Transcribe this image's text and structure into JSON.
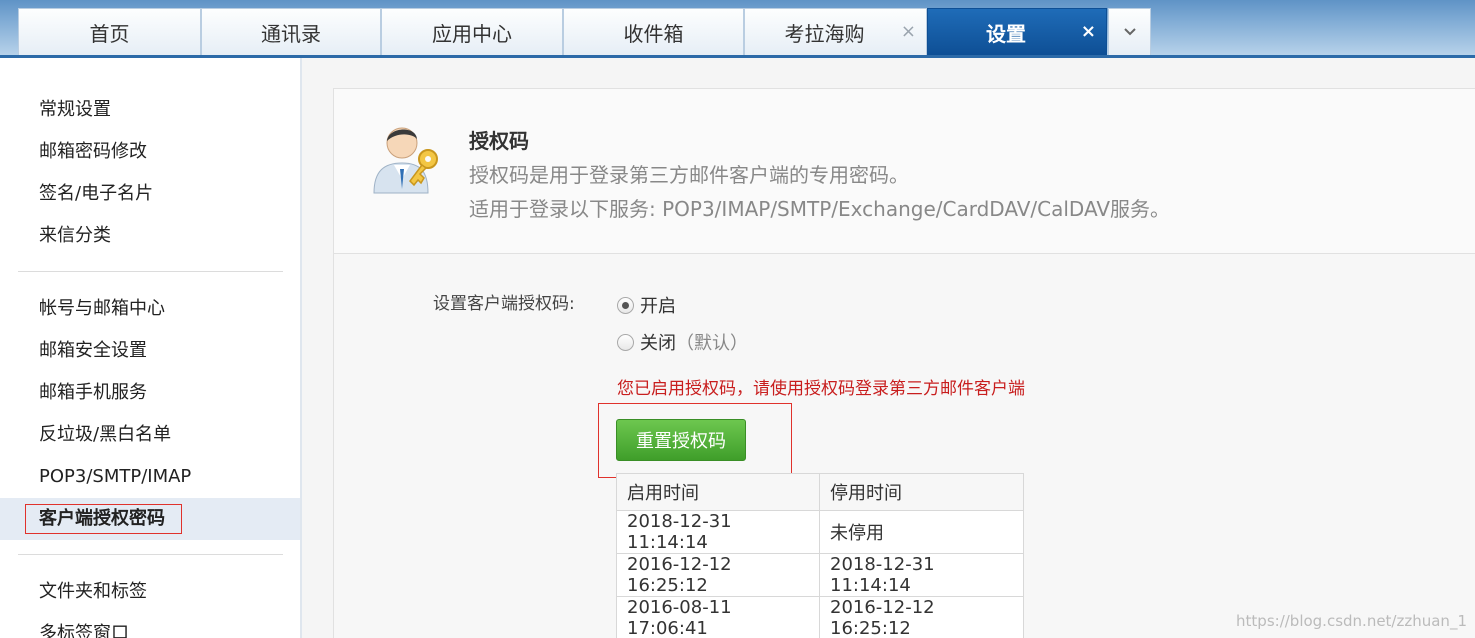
{
  "tabs": [
    {
      "label": "首页"
    },
    {
      "label": "通讯录"
    },
    {
      "label": "应用中心"
    },
    {
      "label": "收件箱"
    },
    {
      "label": "考拉海购",
      "closable": true
    },
    {
      "label": "设置",
      "closable": true,
      "active": true
    }
  ],
  "tab_close_glyph": "×",
  "tab_more_glyph": "⌄",
  "sidebar": {
    "groups": [
      [
        "常规设置",
        "邮箱密码修改",
        "签名/电子名片",
        "来信分类"
      ],
      [
        "帐号与邮箱中心",
        "邮箱安全设置",
        "邮箱手机服务",
        "反垃圾/黑白名单",
        "POP3/SMTP/IMAP",
        "客户端授权密码"
      ],
      [
        "文件夹和标签",
        "多标签窗口"
      ]
    ],
    "active_item": "客户端授权密码"
  },
  "header": {
    "icon": "user-key-icon",
    "title": "授权码",
    "desc1": "授权码是用于登录第三方邮件客户端的专用密码。",
    "desc2": "适用于登录以下服务: POP3/IMAP/SMTP/Exchange/CardDAV/CalDAV服务。"
  },
  "form": {
    "label": "设置客户端授权码:",
    "option_on": "开启",
    "option_off": "关闭",
    "option_off_suffix": "（默认）",
    "selected": "开启",
    "notice": "您已启用授权码，请使用授权码登录第三方邮件客户端",
    "reset_button": "重置授权码"
  },
  "history": {
    "headers": [
      "启用时间",
      "停用时间"
    ],
    "rows": [
      [
        "2018-12-31 11:14:14",
        "未停用"
      ],
      [
        "2016-12-12 16:25:12",
        "2018-12-31 11:14:14"
      ],
      [
        "2016-08-11 17:06:41",
        "2016-12-12 16:25:12"
      ]
    ]
  },
  "watermark": "https://blog.csdn.net/zzhuan_1",
  "colors": {
    "accent": "#0e4f95",
    "notice": "#c81e1e",
    "button": "#4caf32",
    "highlight_box": "#e0322c"
  }
}
